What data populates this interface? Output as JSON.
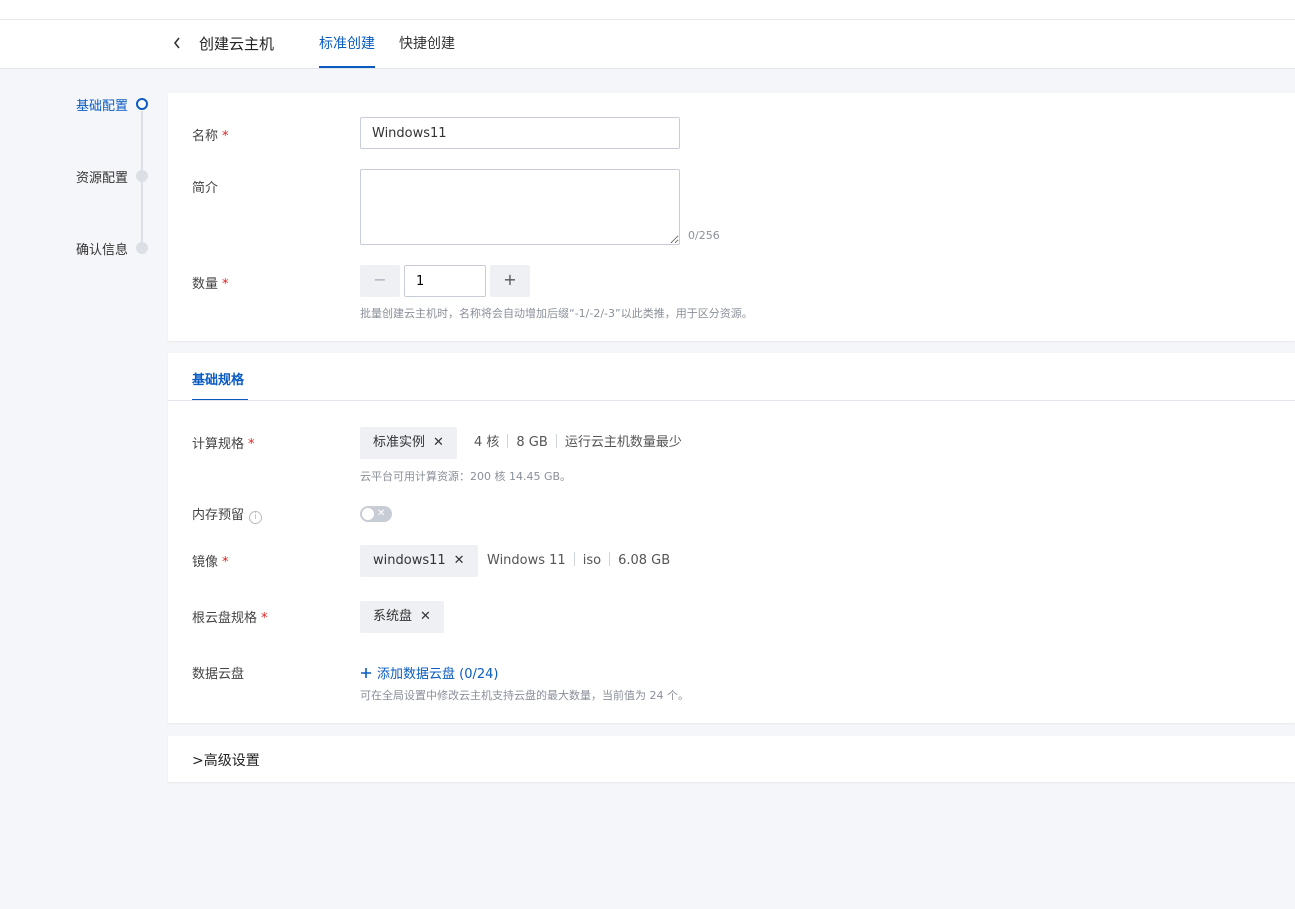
{
  "header": {
    "back_icon": "chevron-left-icon",
    "title": "创建云主机",
    "tabs": [
      {
        "label": "标准创建",
        "active": true
      },
      {
        "label": "快捷创建",
        "active": false
      }
    ]
  },
  "steps": [
    {
      "label": "基础配置",
      "active": true
    },
    {
      "label": "资源配置",
      "active": false
    },
    {
      "label": "确认信息",
      "active": false
    }
  ],
  "basic": {
    "name_label": "名称",
    "name_value": "Windows11",
    "desc_label": "简介",
    "desc_counter": "0/256",
    "qty_label": "数量",
    "qty_minus": "−",
    "qty_value": "1",
    "qty_plus": "+",
    "qty_hint": "批量创建云主机时，名称将会自动增加后缀“-1/-2/-3”以此类推，用于区分资源。"
  },
  "spec": {
    "section_title": "基础规格",
    "compute_label": "计算规格",
    "compute_chip": "标准实例",
    "compute_meta": [
      "4 核",
      "8 GB",
      "运行云主机数量最少"
    ],
    "compute_hint": "云平台可用计算资源：200 核 14.45 GB。",
    "memory_label": "内存预留",
    "memory_reserve_on": false,
    "image_label": "镜像",
    "image_chip": "windows11",
    "image_meta": [
      "Windows 11",
      "iso",
      "6.08 GB"
    ],
    "root_disk_label": "根云盘规格",
    "root_disk_chip": "系统盘",
    "data_disk_label": "数据云盘",
    "add_data_disk": "添加数据云盘 (0/24)",
    "data_disk_hint": "可在全局设置中修改云主机支持云盘的最大数量，当前值为 24 个。",
    "required_mark": "*",
    "close_glyph": "✕"
  },
  "advanced": {
    "label": "高级设置"
  },
  "colors": {
    "accent": "#0a5cc2",
    "required": "#e02020",
    "background": "#f5f6f9"
  }
}
